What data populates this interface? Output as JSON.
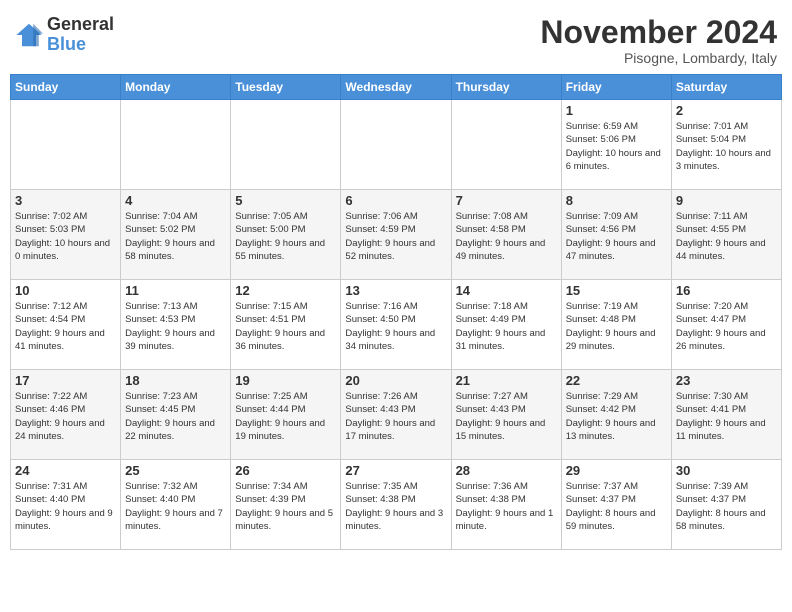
{
  "header": {
    "logo_general": "General",
    "logo_blue": "Blue",
    "month_title": "November 2024",
    "location": "Pisogne, Lombardy, Italy"
  },
  "calendar": {
    "headers": [
      "Sunday",
      "Monday",
      "Tuesday",
      "Wednesday",
      "Thursday",
      "Friday",
      "Saturday"
    ],
    "weeks": [
      [
        {
          "day": "",
          "info": ""
        },
        {
          "day": "",
          "info": ""
        },
        {
          "day": "",
          "info": ""
        },
        {
          "day": "",
          "info": ""
        },
        {
          "day": "",
          "info": ""
        },
        {
          "day": "1",
          "info": "Sunrise: 6:59 AM\nSunset: 5:06 PM\nDaylight: 10 hours and 6 minutes."
        },
        {
          "day": "2",
          "info": "Sunrise: 7:01 AM\nSunset: 5:04 PM\nDaylight: 10 hours and 3 minutes."
        }
      ],
      [
        {
          "day": "3",
          "info": "Sunrise: 7:02 AM\nSunset: 5:03 PM\nDaylight: 10 hours and 0 minutes."
        },
        {
          "day": "4",
          "info": "Sunrise: 7:04 AM\nSunset: 5:02 PM\nDaylight: 9 hours and 58 minutes."
        },
        {
          "day": "5",
          "info": "Sunrise: 7:05 AM\nSunset: 5:00 PM\nDaylight: 9 hours and 55 minutes."
        },
        {
          "day": "6",
          "info": "Sunrise: 7:06 AM\nSunset: 4:59 PM\nDaylight: 9 hours and 52 minutes."
        },
        {
          "day": "7",
          "info": "Sunrise: 7:08 AM\nSunset: 4:58 PM\nDaylight: 9 hours and 49 minutes."
        },
        {
          "day": "8",
          "info": "Sunrise: 7:09 AM\nSunset: 4:56 PM\nDaylight: 9 hours and 47 minutes."
        },
        {
          "day": "9",
          "info": "Sunrise: 7:11 AM\nSunset: 4:55 PM\nDaylight: 9 hours and 44 minutes."
        }
      ],
      [
        {
          "day": "10",
          "info": "Sunrise: 7:12 AM\nSunset: 4:54 PM\nDaylight: 9 hours and 41 minutes."
        },
        {
          "day": "11",
          "info": "Sunrise: 7:13 AM\nSunset: 4:53 PM\nDaylight: 9 hours and 39 minutes."
        },
        {
          "day": "12",
          "info": "Sunrise: 7:15 AM\nSunset: 4:51 PM\nDaylight: 9 hours and 36 minutes."
        },
        {
          "day": "13",
          "info": "Sunrise: 7:16 AM\nSunset: 4:50 PM\nDaylight: 9 hours and 34 minutes."
        },
        {
          "day": "14",
          "info": "Sunrise: 7:18 AM\nSunset: 4:49 PM\nDaylight: 9 hours and 31 minutes."
        },
        {
          "day": "15",
          "info": "Sunrise: 7:19 AM\nSunset: 4:48 PM\nDaylight: 9 hours and 29 minutes."
        },
        {
          "day": "16",
          "info": "Sunrise: 7:20 AM\nSunset: 4:47 PM\nDaylight: 9 hours and 26 minutes."
        }
      ],
      [
        {
          "day": "17",
          "info": "Sunrise: 7:22 AM\nSunset: 4:46 PM\nDaylight: 9 hours and 24 minutes."
        },
        {
          "day": "18",
          "info": "Sunrise: 7:23 AM\nSunset: 4:45 PM\nDaylight: 9 hours and 22 minutes."
        },
        {
          "day": "19",
          "info": "Sunrise: 7:25 AM\nSunset: 4:44 PM\nDaylight: 9 hours and 19 minutes."
        },
        {
          "day": "20",
          "info": "Sunrise: 7:26 AM\nSunset: 4:43 PM\nDaylight: 9 hours and 17 minutes."
        },
        {
          "day": "21",
          "info": "Sunrise: 7:27 AM\nSunset: 4:43 PM\nDaylight: 9 hours and 15 minutes."
        },
        {
          "day": "22",
          "info": "Sunrise: 7:29 AM\nSunset: 4:42 PM\nDaylight: 9 hours and 13 minutes."
        },
        {
          "day": "23",
          "info": "Sunrise: 7:30 AM\nSunset: 4:41 PM\nDaylight: 9 hours and 11 minutes."
        }
      ],
      [
        {
          "day": "24",
          "info": "Sunrise: 7:31 AM\nSunset: 4:40 PM\nDaylight: 9 hours and 9 minutes."
        },
        {
          "day": "25",
          "info": "Sunrise: 7:32 AM\nSunset: 4:40 PM\nDaylight: 9 hours and 7 minutes."
        },
        {
          "day": "26",
          "info": "Sunrise: 7:34 AM\nSunset: 4:39 PM\nDaylight: 9 hours and 5 minutes."
        },
        {
          "day": "27",
          "info": "Sunrise: 7:35 AM\nSunset: 4:38 PM\nDaylight: 9 hours and 3 minutes."
        },
        {
          "day": "28",
          "info": "Sunrise: 7:36 AM\nSunset: 4:38 PM\nDaylight: 9 hours and 1 minute."
        },
        {
          "day": "29",
          "info": "Sunrise: 7:37 AM\nSunset: 4:37 PM\nDaylight: 8 hours and 59 minutes."
        },
        {
          "day": "30",
          "info": "Sunrise: 7:39 AM\nSunset: 4:37 PM\nDaylight: 8 hours and 58 minutes."
        }
      ]
    ]
  }
}
